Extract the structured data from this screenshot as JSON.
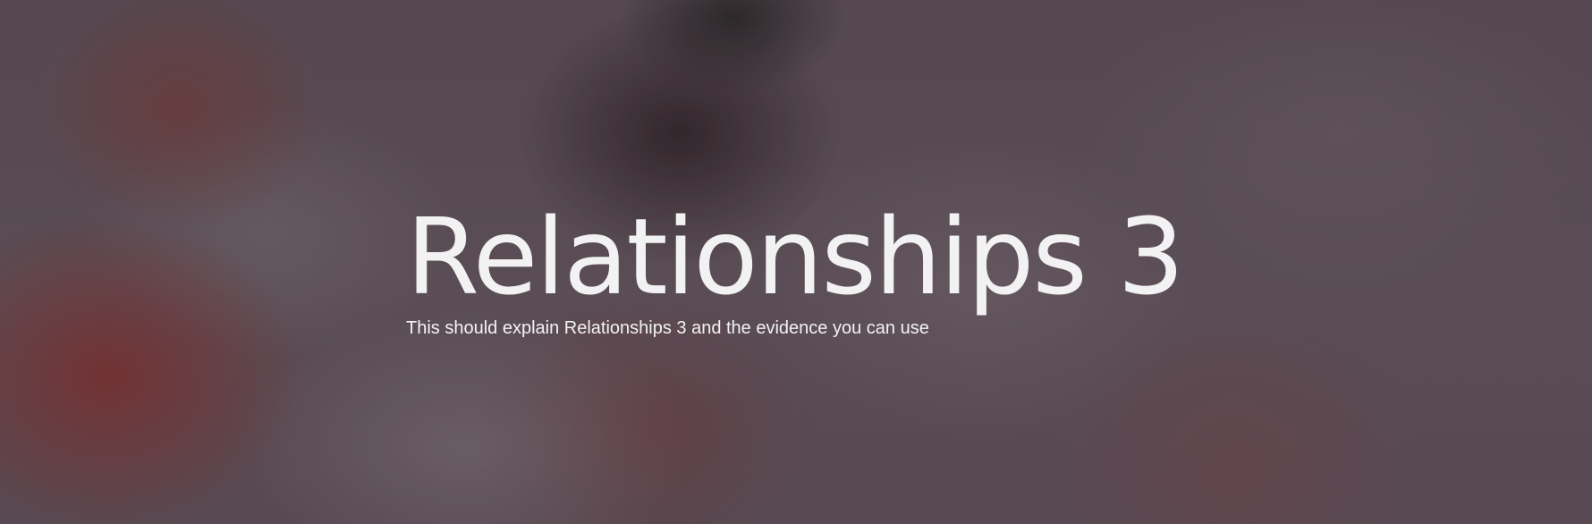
{
  "hero": {
    "title": "Relationships 3",
    "subtitle": "This should explain Relationships 3 and the evidence you can use"
  },
  "colors": {
    "text": "#f2f2f2",
    "background_base": "#5a4c55",
    "accent_red": "#822826"
  }
}
